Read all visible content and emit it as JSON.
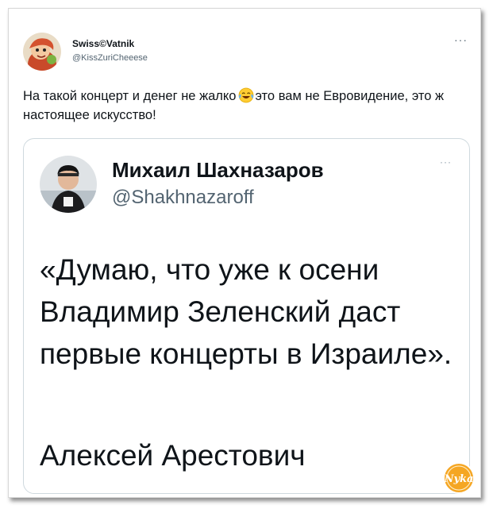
{
  "tweet": {
    "author_name": "Swiss©Vatnik",
    "author_handle": "@KissZuriCheeese",
    "more_label": "···",
    "text_before_emoji": "На такой концерт и денег не жалко",
    "emoji": "face-with-tears-of-joy",
    "text_after_emoji": "это вам не Евровидение, это ж настоящее искусство!"
  },
  "quoted_tweet": {
    "author_name": "Михаил Шахназаров",
    "author_handle": "@Shakhnazaroff",
    "more_label": "···",
    "quote_text": "«Думаю, что уже к осени Владимир Зеленский даст первые концерты в Израиле».",
    "quote_author": "Алексей Арестович"
  },
  "watermark": {
    "text": "Nyka",
    "color": "#f5a623"
  },
  "colors": {
    "text": "#0f1419",
    "secondary": "#536471",
    "border": "#cfd9de"
  }
}
